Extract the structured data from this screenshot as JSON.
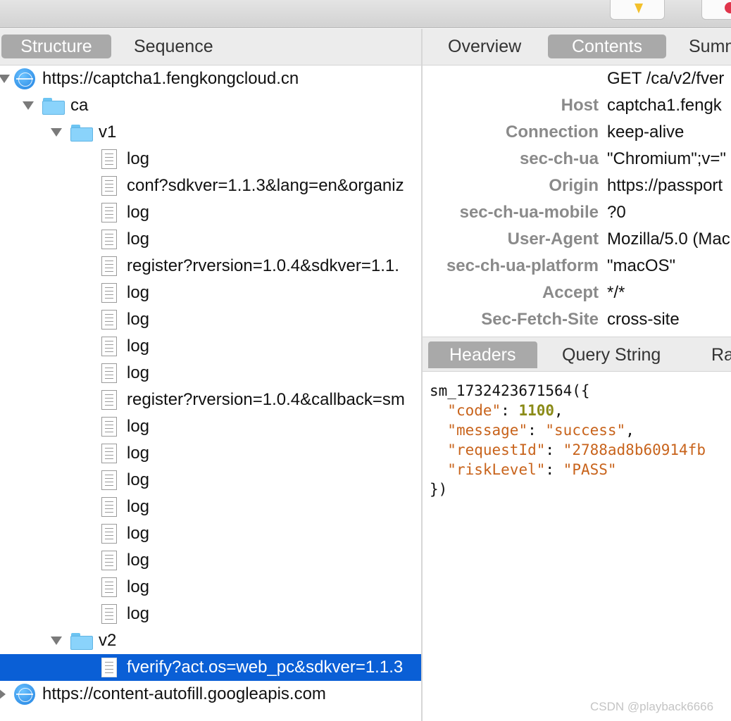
{
  "left_tabs": [
    "Structure",
    "Sequence"
  ],
  "left_active_tab": "Structure",
  "right_tabs": [
    "Overview",
    "Contents",
    "Summ"
  ],
  "right_active_tab": "Contents",
  "tree": [
    {
      "type": "host",
      "label": "https://captcha1.fengkongcloud.cn",
      "expanded": true,
      "level": 0
    },
    {
      "type": "folder",
      "label": "ca",
      "expanded": true,
      "level": 1
    },
    {
      "type": "folder",
      "label": "v1",
      "expanded": true,
      "level": 2
    },
    {
      "type": "file",
      "label": "log",
      "level": 3
    },
    {
      "type": "file",
      "label": "conf?sdkver=1.1.3&lang=en&organiz",
      "level": 3
    },
    {
      "type": "file",
      "label": "log",
      "level": 3
    },
    {
      "type": "file",
      "label": "log",
      "level": 3
    },
    {
      "type": "file",
      "label": "register?rversion=1.0.4&sdkver=1.1.",
      "level": 3
    },
    {
      "type": "file",
      "label": "log",
      "level": 3
    },
    {
      "type": "file",
      "label": "log",
      "level": 3
    },
    {
      "type": "file",
      "label": "log",
      "level": 3
    },
    {
      "type": "file",
      "label": "log",
      "level": 3
    },
    {
      "type": "file",
      "label": "register?rversion=1.0.4&callback=sm",
      "level": 3
    },
    {
      "type": "file",
      "label": "log",
      "level": 3
    },
    {
      "type": "file",
      "label": "log",
      "level": 3
    },
    {
      "type": "file",
      "label": "log",
      "level": 3
    },
    {
      "type": "file",
      "label": "log",
      "level": 3
    },
    {
      "type": "file",
      "label": "log",
      "level": 3
    },
    {
      "type": "file",
      "label": "log",
      "level": 3
    },
    {
      "type": "file",
      "label": "log",
      "level": 3
    },
    {
      "type": "file",
      "label": "log",
      "level": 3
    },
    {
      "type": "folder",
      "label": "v2",
      "expanded": true,
      "level": 2
    },
    {
      "type": "file",
      "label": "fverify?act.os=web_pc&sdkver=1.1.3",
      "level": 3,
      "selected": true
    },
    {
      "type": "host",
      "label": "https://content-autofill.googleapis.com",
      "expanded": false,
      "level": 0
    }
  ],
  "request_line": "GET /ca/v2/fver",
  "headers": [
    {
      "key": "Host",
      "value": "captcha1.fengk"
    },
    {
      "key": "Connection",
      "value": "keep-alive"
    },
    {
      "key": "sec-ch-ua",
      "value": "\"Chromium\";v=\""
    },
    {
      "key": "Origin",
      "value": "https://passport"
    },
    {
      "key": "sec-ch-ua-mobile",
      "value": "?0"
    },
    {
      "key": "User-Agent",
      "value": "Mozilla/5.0 (Mac"
    },
    {
      "key": "sec-ch-ua-platform",
      "value": "\"macOS\""
    },
    {
      "key": "Accept",
      "value": "*/*"
    },
    {
      "key": "Sec-Fetch-Site",
      "value": "cross-site"
    }
  ],
  "response_tabs": [
    "Headers",
    "Query String",
    "Ra"
  ],
  "response_active_tab": "Headers",
  "response": {
    "callback": "sm_1732423671564({",
    "code_key": "\"code\"",
    "code_val": "1100",
    "message_key": "\"message\"",
    "message_val": "\"success\"",
    "requestId_key": "\"requestId\"",
    "requestId_val": "\"2788ad8b60914fb",
    "riskLevel_key": "\"riskLevel\"",
    "riskLevel_val": "\"PASS\"",
    "close": "})"
  },
  "watermark": "CSDN @playback6666",
  "colors": {
    "selection": "#0a5fd6",
    "tab_active": "#a9a9a9",
    "json_key": "#c8631b",
    "json_number": "#8b8b18"
  }
}
